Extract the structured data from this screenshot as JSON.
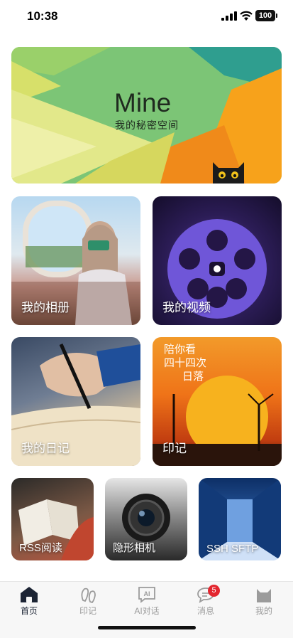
{
  "status": {
    "time": "10:38",
    "battery": "100"
  },
  "banner": {
    "title": "Mine",
    "subtitle": "我的秘密空间"
  },
  "cards": {
    "album": "我的相册",
    "video": "我的视频",
    "diary": "我的日记",
    "mark": "印记",
    "mark_poster": [
      "陪你看",
      "四十四次",
      "日落"
    ],
    "rss": "RSS阅读",
    "camera": "隐形相机",
    "ssh": "SSH SFTP"
  },
  "tabs": [
    {
      "label": "首页",
      "icon": "home-icon",
      "active": true
    },
    {
      "label": "印记",
      "icon": "footprint-icon",
      "active": false
    },
    {
      "label": "AI对话",
      "icon": "ai-chat-icon",
      "active": false
    },
    {
      "label": "消息",
      "icon": "message-icon",
      "active": false,
      "badge": "5"
    },
    {
      "label": "我的",
      "icon": "cat-profile-icon",
      "active": false
    }
  ],
  "colors": {
    "active_tab": "#1c2434",
    "inactive_tab": "#9b9b9b",
    "badge": "#e3262f"
  }
}
